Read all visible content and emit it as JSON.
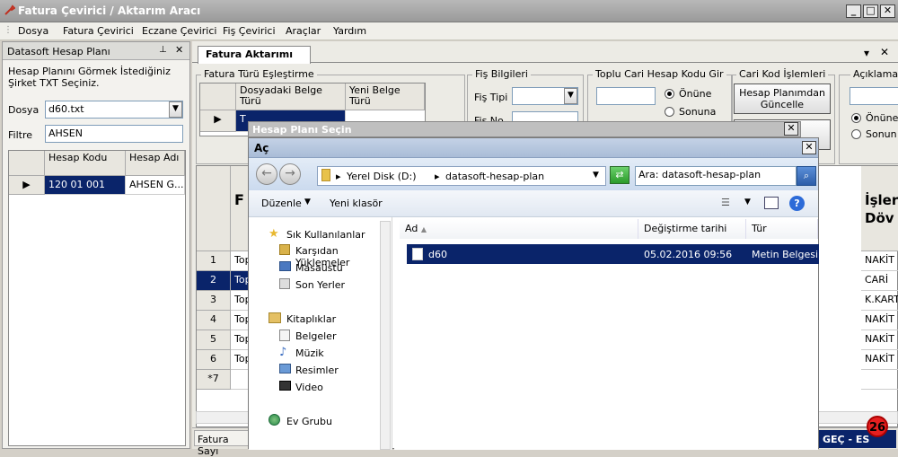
{
  "window": {
    "title": "Fatura Çevirici / Aktarım Aracı",
    "min": "_",
    "max": "□",
    "close": "✕"
  },
  "menu": [
    "Dosya",
    "Fatura Çevirici",
    "Eczane Çevirici",
    "Fiş Çevirici",
    "Araçlar",
    "Yardım"
  ],
  "left_panel": {
    "title": "Datasoft Hesap Planı",
    "pin": "📌",
    "close": "✕",
    "instruction": "Hesap Planını Görmek İstediğiniz Şirket TXT Seçiniz.",
    "dosya_label": "Dosya",
    "dosya_value": "d60.txt",
    "filtre_label": "Filtre",
    "filtre_value": "AHSEN",
    "grid": {
      "headers": [
        "Hesap Kodu",
        "Hesap Adı"
      ],
      "rows": [
        [
          "120 01 001",
          "AHSEN G..."
        ]
      ]
    }
  },
  "tab": {
    "label": "Fatura Aktarımı",
    "arrow": "▾",
    "close": "✕"
  },
  "fatura_turu": {
    "title": "Fatura Türü Eşleştirme",
    "headers": [
      "Dosyadaki Belge Türü",
      "Yeni Belge Türü"
    ],
    "row_first": "T"
  },
  "fis_bilgileri": {
    "title": "Fiş Bilgileri",
    "fis_tipi": "Fiş Tipi",
    "fis_no_partial": "Fiş No"
  },
  "toplu_cari": {
    "title": "Toplu Cari Hesap Kodu Gir",
    "onune": "Önüne",
    "sonuna": "Sonuna"
  },
  "cari_kod": {
    "title": "Cari Kod İşlemleri",
    "button": "Hesap Planımdan Güncelle",
    "button2_partial": "le"
  },
  "aciklama": {
    "title": "Açıklama",
    "onune": "Önüne",
    "sonuna": "Sonun"
  },
  "main_grid": {
    "header_partial_left": "F T",
    "header_partial_right": "İşler Döv",
    "row_numbers": [
      "1",
      "2",
      "3",
      "4",
      "5",
      "6",
      "*7"
    ],
    "left_cells": [
      "Top",
      "Top",
      "Top",
      "Top",
      "Top",
      "Top",
      ""
    ],
    "right_cells": [
      "NAKİT",
      "CARİ",
      "K.KART",
      "NAKİT",
      "NAKİT",
      "NAKİT",
      ""
    ],
    "selected_row": 2
  },
  "status": {
    "fatura_sayisi": "Fatura Sayı",
    "gec_partial": "GEÇ - ES",
    "badge": "26"
  },
  "back_dialog": {
    "title": "Hesap Planı Seçin",
    "close": "✕"
  },
  "dialog": {
    "title": "Aç",
    "close": "✕",
    "path": [
      "Yerel Disk (D:)",
      "datasoft-hesap-plan"
    ],
    "search_placeholder": "Ara: datasoft-hesap-plan",
    "toolbar": {
      "organize": "Düzenle",
      "new_folder": "Yeni klasör"
    },
    "nav": {
      "favorites": "Sık Kullanılanlar",
      "fav_items": [
        "Karşıdan Yüklemeler",
        "Masaüstü",
        "Son Yerler"
      ],
      "libraries": "Kitaplıklar",
      "lib_items": [
        "Belgeler",
        "Müzik",
        "Resimler",
        "Video"
      ],
      "homegroup": "Ev Grubu"
    },
    "columns": [
      "Ad",
      "Değiştirme tarihi",
      "Tür"
    ],
    "files": [
      {
        "name": "d60",
        "date": "05.02.2016 09:56",
        "type": "Metin Belgesi"
      }
    ]
  },
  "colors": {
    "selection": "#0a246a",
    "badge": "#e52020"
  }
}
